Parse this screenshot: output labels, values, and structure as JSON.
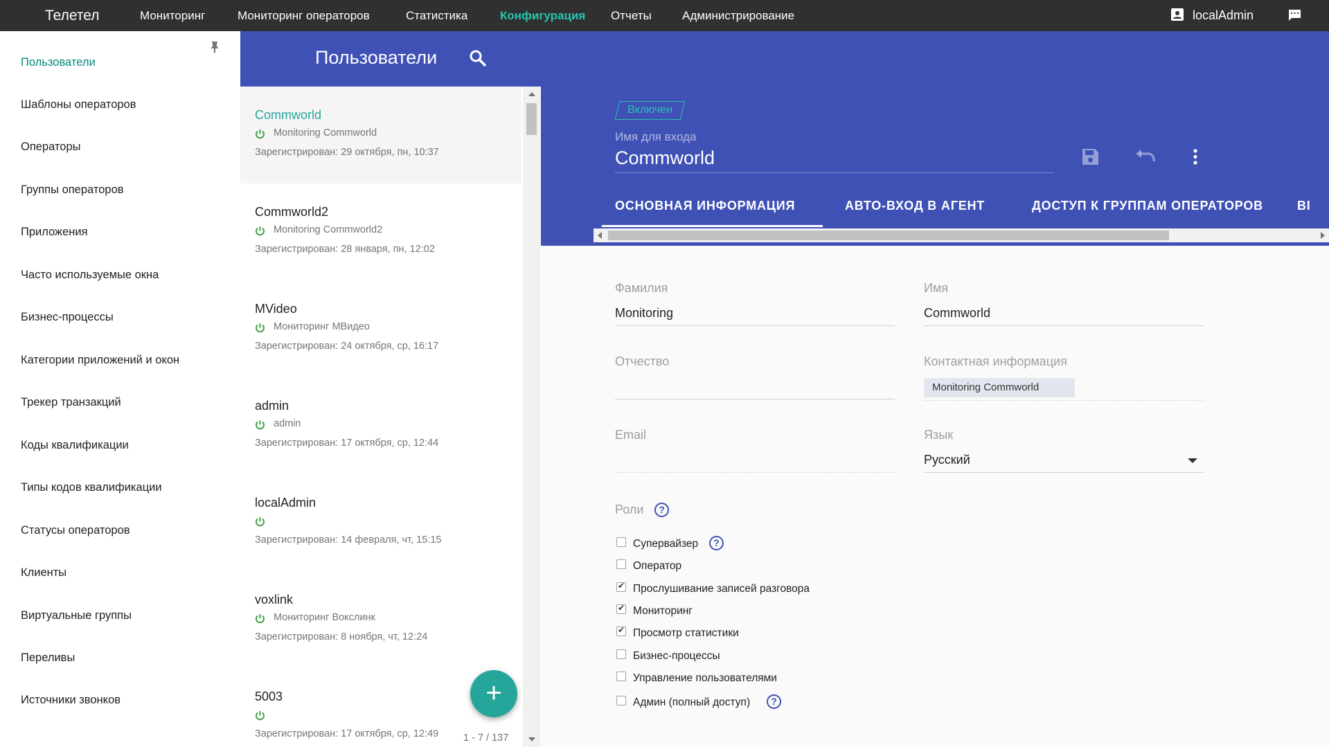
{
  "topnav": {
    "brand": "Телетел",
    "items": [
      {
        "label": "Мониторинг",
        "active": false
      },
      {
        "label": "Мониторинг операторов",
        "active": false
      },
      {
        "label": "Статистика",
        "active": false
      },
      {
        "label": "Конфигурация",
        "active": true
      },
      {
        "label": "Отчеты",
        "active": false
      },
      {
        "label": "Администрирование",
        "active": false
      }
    ],
    "user": "localAdmin",
    "user_icon": "account-box-icon",
    "chat_icon": "chat-icon"
  },
  "sidebar": {
    "pin_icon": "pin-icon",
    "items": [
      {
        "label": "Пользователи",
        "active": true
      },
      {
        "label": "Шаблоны операторов"
      },
      {
        "label": "Операторы"
      },
      {
        "label": "Группы операторов"
      },
      {
        "label": "Приложения"
      },
      {
        "label": "Часто используемые окна"
      },
      {
        "label": "Бизнес-процессы"
      },
      {
        "label": "Категории приложений и окон"
      },
      {
        "label": "Трекер транзакций"
      },
      {
        "label": "Коды квалификации"
      },
      {
        "label": "Типы кодов квалификации"
      },
      {
        "label": "Статусы операторов"
      },
      {
        "label": "Клиенты"
      },
      {
        "label": "Виртуальные группы"
      },
      {
        "label": "Переливы"
      },
      {
        "label": "Источники звонков"
      }
    ]
  },
  "header": {
    "title": "Пользователи",
    "search_icon": "search-icon"
  },
  "users": [
    {
      "name": "Commworld",
      "contact": "Monitoring Commworld",
      "registered": "Зарегистрирован: 29 октября, пн, 10:37",
      "selected": true
    },
    {
      "name": "Commworld2",
      "contact": "Monitoring Commworld2",
      "registered": "Зарегистрирован: 28 января, пн, 12:02"
    },
    {
      "name": "MVideo",
      "contact": "Мониторинг МВидео",
      "registered": "Зарегистрирован: 24 октября, ср, 16:17"
    },
    {
      "name": "admin",
      "contact": "admin",
      "registered": "Зарегистрирован: 17 октября, ср, 12:44"
    },
    {
      "name": "localAdmin",
      "contact": "",
      "registered": "Зарегистрирован: 14 февраля, чт, 15:15"
    },
    {
      "name": "voxlink",
      "contact": "Мониторинг Вокслинк",
      "registered": "Зарегистрирован: 8 ноября, чт, 12:24"
    },
    {
      "name": "5003",
      "contact": "",
      "registered": "Зарегистрирован: 17 октября, ср, 12:49"
    }
  ],
  "pager": "1 - 7 / 137",
  "fab_icon": "plus-icon",
  "details": {
    "status_badge": "Включен",
    "login_label": "Имя для входа",
    "login_value": "Commworld",
    "tabs": [
      "ОСНОВНАЯ ИНФОРМАЦИЯ",
      "АВТО-ВХОД В АГЕНТ",
      "ДОСТУП К ГРУППАМ ОПЕРАТОРОВ",
      "ВІ"
    ],
    "active_tab": 0,
    "form": {
      "last_name_label": "Фамилия",
      "last_name_value": "Monitoring",
      "first_name_label": "Имя",
      "first_name_value": "Commworld",
      "middle_name_label": "Отчество",
      "middle_name_value": "",
      "contact_label": "Контактная информация",
      "contact_value": "Monitoring Commworld",
      "email_label": "Email",
      "email_value": "",
      "language_label": "Язык",
      "language_value": "Русский",
      "roles_label": "Роли"
    },
    "roles": [
      {
        "label": "Супервайзер",
        "checked": false,
        "help": true
      },
      {
        "label": "Оператор",
        "checked": false
      },
      {
        "label": "Прослушивание записей разговора",
        "checked": true
      },
      {
        "label": "Мониторинг",
        "checked": true
      },
      {
        "label": "Просмотр статистики",
        "checked": true
      },
      {
        "label": "Бизнес-процессы",
        "checked": false
      },
      {
        "label": "Управление пользователями",
        "checked": false
      },
      {
        "label": "Админ (полный доступ)",
        "checked": false,
        "help": true
      }
    ]
  },
  "colors": {
    "primary": "#3f51b5",
    "accent": "#26a69a",
    "topbar": "#303030",
    "power_icon": "#43a047"
  }
}
